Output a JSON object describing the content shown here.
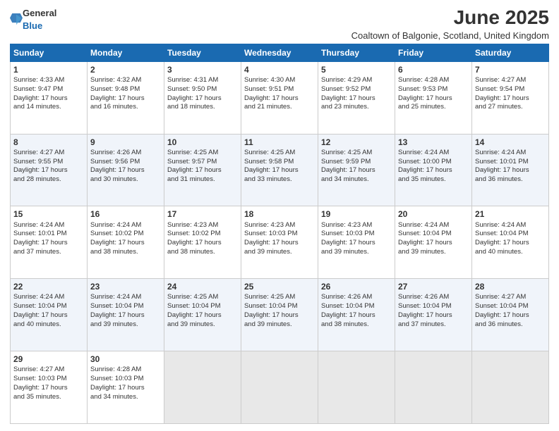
{
  "header": {
    "logo_general": "General",
    "logo_blue": "Blue",
    "title": "June 2025",
    "location": "Coaltown of Balgonie, Scotland, United Kingdom"
  },
  "days_of_week": [
    "Sunday",
    "Monday",
    "Tuesday",
    "Wednesday",
    "Thursday",
    "Friday",
    "Saturday"
  ],
  "weeks": [
    [
      {
        "day": "1",
        "lines": [
          "Sunrise: 4:33 AM",
          "Sunset: 9:47 PM",
          "Daylight: 17 hours",
          "and 14 minutes."
        ]
      },
      {
        "day": "2",
        "lines": [
          "Sunrise: 4:32 AM",
          "Sunset: 9:48 PM",
          "Daylight: 17 hours",
          "and 16 minutes."
        ]
      },
      {
        "day": "3",
        "lines": [
          "Sunrise: 4:31 AM",
          "Sunset: 9:50 PM",
          "Daylight: 17 hours",
          "and 18 minutes."
        ]
      },
      {
        "day": "4",
        "lines": [
          "Sunrise: 4:30 AM",
          "Sunset: 9:51 PM",
          "Daylight: 17 hours",
          "and 21 minutes."
        ]
      },
      {
        "day": "5",
        "lines": [
          "Sunrise: 4:29 AM",
          "Sunset: 9:52 PM",
          "Daylight: 17 hours",
          "and 23 minutes."
        ]
      },
      {
        "day": "6",
        "lines": [
          "Sunrise: 4:28 AM",
          "Sunset: 9:53 PM",
          "Daylight: 17 hours",
          "and 25 minutes."
        ]
      },
      {
        "day": "7",
        "lines": [
          "Sunrise: 4:27 AM",
          "Sunset: 9:54 PM",
          "Daylight: 17 hours",
          "and 27 minutes."
        ]
      }
    ],
    [
      {
        "day": "8",
        "lines": [
          "Sunrise: 4:27 AM",
          "Sunset: 9:55 PM",
          "Daylight: 17 hours",
          "and 28 minutes."
        ]
      },
      {
        "day": "9",
        "lines": [
          "Sunrise: 4:26 AM",
          "Sunset: 9:56 PM",
          "Daylight: 17 hours",
          "and 30 minutes."
        ]
      },
      {
        "day": "10",
        "lines": [
          "Sunrise: 4:25 AM",
          "Sunset: 9:57 PM",
          "Daylight: 17 hours",
          "and 31 minutes."
        ]
      },
      {
        "day": "11",
        "lines": [
          "Sunrise: 4:25 AM",
          "Sunset: 9:58 PM",
          "Daylight: 17 hours",
          "and 33 minutes."
        ]
      },
      {
        "day": "12",
        "lines": [
          "Sunrise: 4:25 AM",
          "Sunset: 9:59 PM",
          "Daylight: 17 hours",
          "and 34 minutes."
        ]
      },
      {
        "day": "13",
        "lines": [
          "Sunrise: 4:24 AM",
          "Sunset: 10:00 PM",
          "Daylight: 17 hours",
          "and 35 minutes."
        ]
      },
      {
        "day": "14",
        "lines": [
          "Sunrise: 4:24 AM",
          "Sunset: 10:01 PM",
          "Daylight: 17 hours",
          "and 36 minutes."
        ]
      }
    ],
    [
      {
        "day": "15",
        "lines": [
          "Sunrise: 4:24 AM",
          "Sunset: 10:01 PM",
          "Daylight: 17 hours",
          "and 37 minutes."
        ]
      },
      {
        "day": "16",
        "lines": [
          "Sunrise: 4:24 AM",
          "Sunset: 10:02 PM",
          "Daylight: 17 hours",
          "and 38 minutes."
        ]
      },
      {
        "day": "17",
        "lines": [
          "Sunrise: 4:23 AM",
          "Sunset: 10:02 PM",
          "Daylight: 17 hours",
          "and 38 minutes."
        ]
      },
      {
        "day": "18",
        "lines": [
          "Sunrise: 4:23 AM",
          "Sunset: 10:03 PM",
          "Daylight: 17 hours",
          "and 39 minutes."
        ]
      },
      {
        "day": "19",
        "lines": [
          "Sunrise: 4:23 AM",
          "Sunset: 10:03 PM",
          "Daylight: 17 hours",
          "and 39 minutes."
        ]
      },
      {
        "day": "20",
        "lines": [
          "Sunrise: 4:24 AM",
          "Sunset: 10:04 PM",
          "Daylight: 17 hours",
          "and 39 minutes."
        ]
      },
      {
        "day": "21",
        "lines": [
          "Sunrise: 4:24 AM",
          "Sunset: 10:04 PM",
          "Daylight: 17 hours",
          "and 40 minutes."
        ]
      }
    ],
    [
      {
        "day": "22",
        "lines": [
          "Sunrise: 4:24 AM",
          "Sunset: 10:04 PM",
          "Daylight: 17 hours",
          "and 40 minutes."
        ]
      },
      {
        "day": "23",
        "lines": [
          "Sunrise: 4:24 AM",
          "Sunset: 10:04 PM",
          "Daylight: 17 hours",
          "and 39 minutes."
        ]
      },
      {
        "day": "24",
        "lines": [
          "Sunrise: 4:25 AM",
          "Sunset: 10:04 PM",
          "Daylight: 17 hours",
          "and 39 minutes."
        ]
      },
      {
        "day": "25",
        "lines": [
          "Sunrise: 4:25 AM",
          "Sunset: 10:04 PM",
          "Daylight: 17 hours",
          "and 39 minutes."
        ]
      },
      {
        "day": "26",
        "lines": [
          "Sunrise: 4:26 AM",
          "Sunset: 10:04 PM",
          "Daylight: 17 hours",
          "and 38 minutes."
        ]
      },
      {
        "day": "27",
        "lines": [
          "Sunrise: 4:26 AM",
          "Sunset: 10:04 PM",
          "Daylight: 17 hours",
          "and 37 minutes."
        ]
      },
      {
        "day": "28",
        "lines": [
          "Sunrise: 4:27 AM",
          "Sunset: 10:04 PM",
          "Daylight: 17 hours",
          "and 36 minutes."
        ]
      }
    ],
    [
      {
        "day": "29",
        "lines": [
          "Sunrise: 4:27 AM",
          "Sunset: 10:03 PM",
          "Daylight: 17 hours",
          "and 35 minutes."
        ]
      },
      {
        "day": "30",
        "lines": [
          "Sunrise: 4:28 AM",
          "Sunset: 10:03 PM",
          "Daylight: 17 hours",
          "and 34 minutes."
        ]
      },
      {
        "day": "",
        "lines": []
      },
      {
        "day": "",
        "lines": []
      },
      {
        "day": "",
        "lines": []
      },
      {
        "day": "",
        "lines": []
      },
      {
        "day": "",
        "lines": []
      }
    ]
  ]
}
